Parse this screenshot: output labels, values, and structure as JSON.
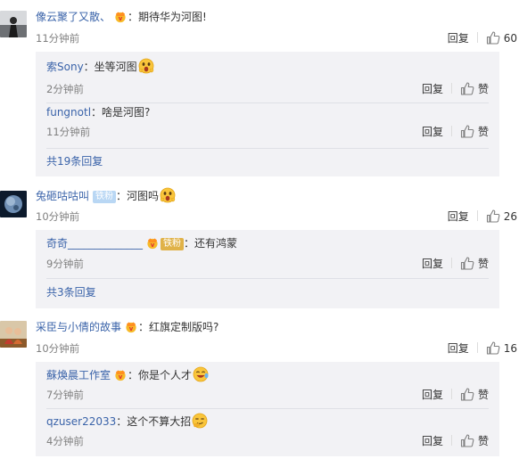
{
  "comments": [
    {
      "user": "像云聚了又散、",
      "text": "：期待华为河图!",
      "time": "11分钟前",
      "reply_label": "回复",
      "likes": "60",
      "replies": [
        {
          "user": "索Sony",
          "text": "：坐等河图",
          "time": "2分钟前",
          "reply_label": "回复",
          "likes": "赞"
        },
        {
          "user": "fungnotl",
          "text": "：啥是河图?",
          "time": "11分钟前",
          "reply_label": "回复",
          "likes": "赞"
        }
      ],
      "more": "共19条回复"
    },
    {
      "user": "兔砸咕咕叫",
      "badge": "铁粉",
      "text": "：河图吗",
      "time": "10分钟前",
      "reply_label": "回复",
      "likes": "26",
      "replies": [
        {
          "user": "奇奇______________",
          "badge": "铁粉",
          "text": "：还有鸿蒙",
          "time": "9分钟前",
          "reply_label": "回复",
          "likes": "赞"
        }
      ],
      "more": "共3条回复"
    },
    {
      "user": "采臣与小倩的故事",
      "text": "：红旗定制版吗?",
      "time": "10分钟前",
      "reply_label": "回复",
      "likes": "16",
      "replies": [
        {
          "user": "蘇煥晨工作室",
          "text": "：你是个人才",
          "time": "7分钟前",
          "reply_label": "回复",
          "likes": "赞"
        },
        {
          "user": "qzuser22033",
          "text": "：这个不算大招",
          "time": "4分钟前",
          "reply_label": "回复",
          "likes": "赞"
        }
      ]
    }
  ],
  "colors": {
    "link": "#3a63a9",
    "subBg": "#f2f2f5",
    "time": "#808080"
  }
}
